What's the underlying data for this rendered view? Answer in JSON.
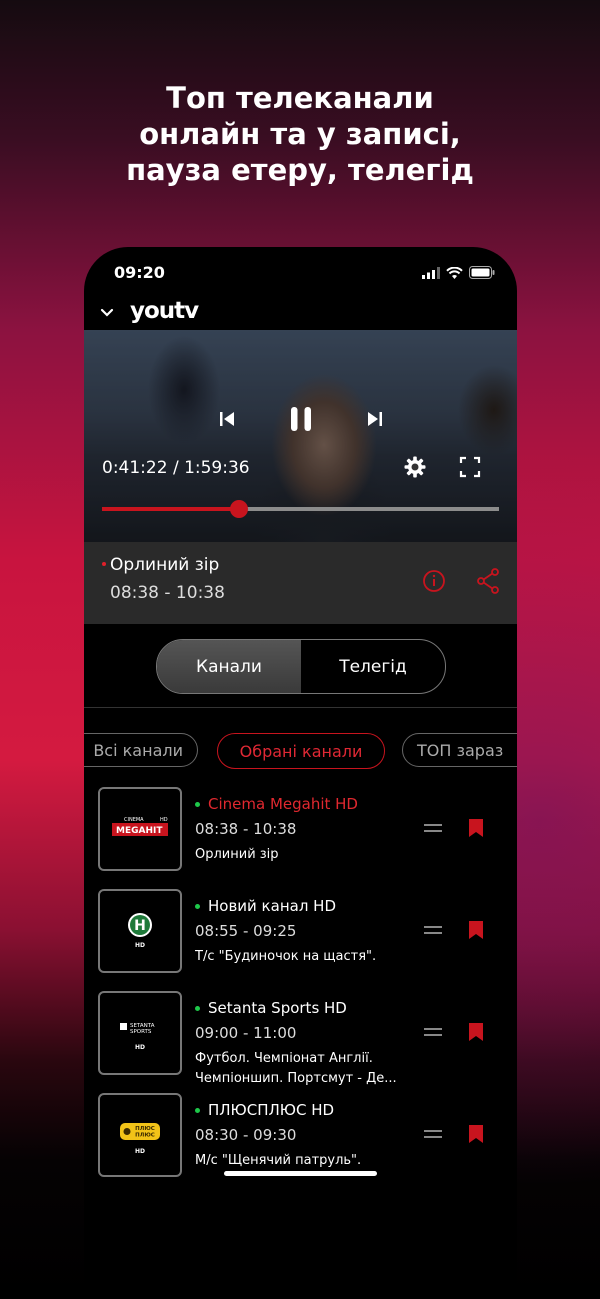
{
  "headline": [
    "Топ телеканали",
    "онлайн та у записі,",
    "пауза етеру, телегід"
  ],
  "status_bar": {
    "time": "09:20"
  },
  "app": {
    "logo": "youtv"
  },
  "player": {
    "time_label": "0:41:22 / 1:59:36",
    "progress_fraction": 0.345,
    "controls": [
      "previous-icon",
      "pause-icon",
      "next-icon",
      "settings-gear-icon",
      "fullscreen-icon"
    ]
  },
  "now_playing": {
    "title": "Орлиний зір",
    "time_range": "08:38 - 10:38"
  },
  "segment": {
    "channels": "Канали",
    "tvguide": "Телегід",
    "active": "channels"
  },
  "chips": [
    "Всі канали",
    "Обрані канали",
    "ТОП зараз"
  ],
  "channel_list": [
    {
      "name": "Cinema Megahit HD",
      "time": "08:38 - 10:38",
      "program": "Орлиний зір",
      "logo_text": [
        "CINEMA",
        "MEGAHIT",
        "HD"
      ],
      "active": true
    },
    {
      "name": "Новий канал HD",
      "time": "08:55 - 09:25",
      "program": "Т/с \"Будиночок на щастя\".",
      "logo_text": [
        "H",
        "HD"
      ],
      "active": false
    },
    {
      "name": "Setanta Sports HD",
      "time": "09:00 - 11:00",
      "program_lines": [
        "Футбол. Чемпіонат Англії.",
        "Чемпіоншип. Портсмут - Де..."
      ],
      "logo_text": [
        "SETANTA",
        "SPORTS",
        "HD"
      ],
      "active": false
    },
    {
      "name": "ПЛЮСПЛЮС HD",
      "time": "08:30 - 09:30",
      "program": "М/с \"Щенячий патруль\".",
      "logo_text": [
        "ПЛЮС",
        "ПЛЮС",
        "HD"
      ],
      "active": false
    }
  ],
  "colors": {
    "accent": "#c8141e",
    "live_dot": "#1ec84a",
    "panel": "#2a2a2a"
  }
}
